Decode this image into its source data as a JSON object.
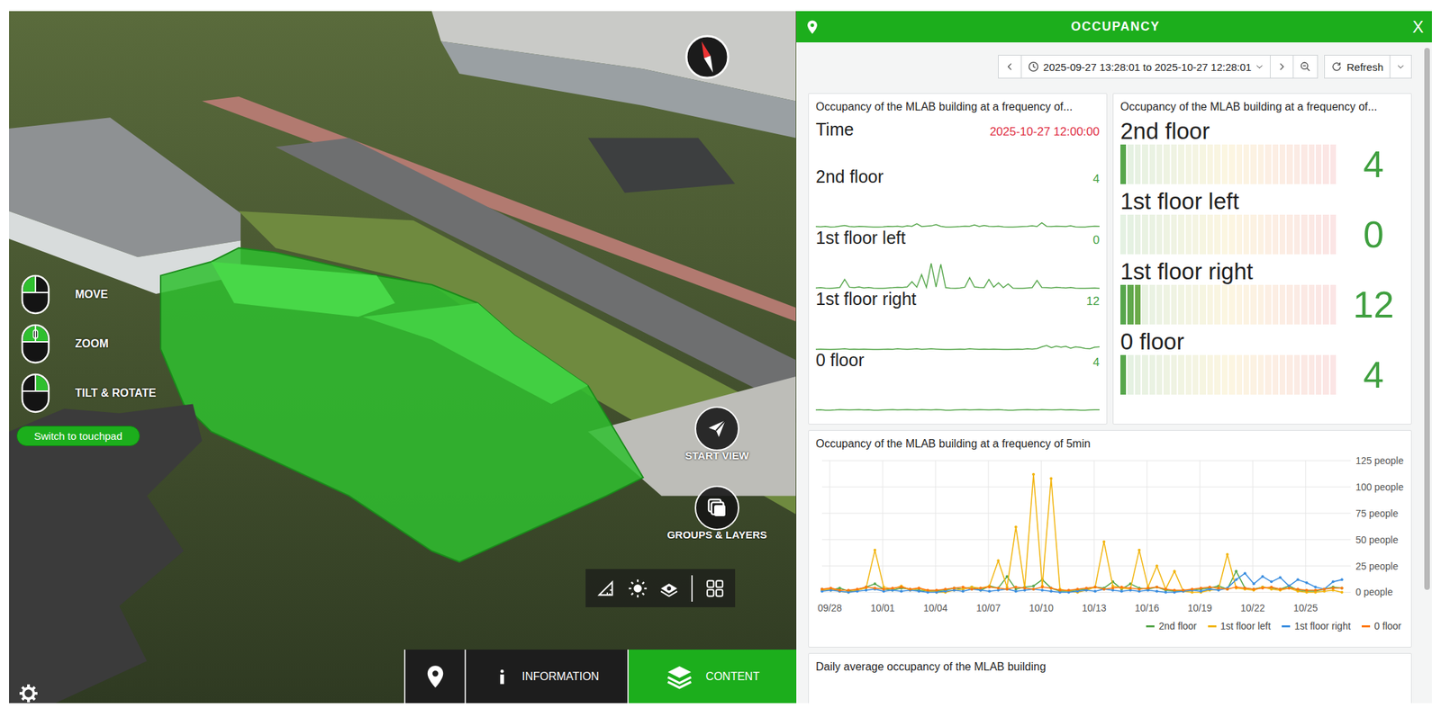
{
  "map": {
    "controls": [
      {
        "label": "MOVE"
      },
      {
        "label": "ZOOM"
      },
      {
        "label": "TILT & ROTATE"
      }
    ],
    "touchpad_button": "Switch to touchpad",
    "actions": [
      {
        "label": "START VIEW"
      },
      {
        "label": "GROUPS & LAYERS"
      }
    ],
    "bottom_bar": [
      {
        "kind": "pin",
        "selected": false
      },
      {
        "kind": "info",
        "label": "INFORMATION",
        "selected": false
      },
      {
        "kind": "content",
        "label": "CONTENT",
        "selected": true
      }
    ]
  },
  "panel": {
    "title": "OCCUPANCY",
    "close": "X",
    "time_range": "2025-09-27 13:28:01 to 2025-10-27 12:28:01",
    "refresh": "Refresh"
  },
  "stat_panel": {
    "title": "Occupancy of the MLAB building at a frequency of...",
    "time_label": "Time",
    "time_value": "2025-10-27 12:00:00",
    "rows": [
      {
        "name": "2nd floor",
        "value": "4"
      },
      {
        "name": "1st floor left",
        "value": "0"
      },
      {
        "name": "1st floor right",
        "value": "12"
      },
      {
        "name": "0 floor",
        "value": "4"
      }
    ]
  },
  "gauge_panel": {
    "title": "Occupancy of the MLAB building at a frequency of...",
    "rows": [
      {
        "name": "2nd floor",
        "value": "4",
        "level": 0.032
      },
      {
        "name": "1st floor left",
        "value": "0",
        "level": 0
      },
      {
        "name": "1st floor right",
        "value": "12",
        "level": 0.096
      },
      {
        "name": "0 floor",
        "value": "4",
        "level": 0.032
      }
    ]
  },
  "chart": {
    "title": "Occupancy of the MLAB building at a frequency of 5min",
    "y_ticks": [
      "0 people",
      "25 people",
      "50 people",
      "75 people",
      "100 people",
      "125 people"
    ],
    "x_ticks": [
      "09/28",
      "10/01",
      "10/04",
      "10/07",
      "10/10",
      "10/13",
      "10/16",
      "10/19",
      "10/22",
      "10/25"
    ],
    "series": [
      {
        "name": "2nd floor",
        "color": "#56a64b",
        "values": [
          3,
          2,
          4,
          1,
          2,
          5,
          8,
          3,
          2,
          4,
          3,
          2,
          1,
          1,
          2,
          4,
          3,
          5,
          2,
          6,
          4,
          15,
          3,
          5,
          6,
          12,
          4,
          1,
          1,
          2,
          3,
          5,
          4,
          10,
          3,
          8,
          4,
          3,
          5,
          2,
          1,
          1,
          2,
          3,
          4,
          6,
          3,
          20,
          4,
          3,
          5,
          4,
          3,
          6,
          2,
          1,
          1,
          3,
          5,
          4
        ]
      },
      {
        "name": "1st floor left",
        "color": "#f2b50f",
        "values": [
          2,
          3,
          1,
          0,
          2,
          4,
          40,
          5,
          3,
          6,
          2,
          4,
          1,
          0,
          0,
          2,
          3,
          5,
          4,
          6,
          30,
          5,
          62,
          4,
          112,
          6,
          108,
          3,
          1,
          0,
          2,
          5,
          48,
          6,
          4,
          3,
          40,
          5,
          25,
          3,
          20,
          1,
          0,
          0,
          2,
          3,
          36,
          4,
          3,
          2,
          5,
          3,
          2,
          4,
          1,
          0,
          0,
          1,
          2,
          0
        ]
      },
      {
        "name": "1st floor right",
        "color": "#3d8fe0",
        "values": [
          1,
          2,
          1,
          0,
          1,
          2,
          3,
          1,
          2,
          1,
          2,
          1,
          0,
          0,
          1,
          2,
          1,
          3,
          2,
          1,
          2,
          3,
          1,
          2,
          3,
          2,
          1,
          0,
          0,
          1,
          2,
          1,
          3,
          2,
          1,
          2,
          1,
          2,
          1,
          0,
          0,
          1,
          2,
          1,
          3,
          2,
          4,
          12,
          18,
          8,
          15,
          10,
          14,
          6,
          12,
          9,
          5,
          3,
          10,
          12
        ]
      },
      {
        "name": "0 floor",
        "color": "#ff780a",
        "values": [
          3,
          4,
          2,
          2,
          3,
          5,
          4,
          3,
          4,
          5,
          3,
          4,
          2,
          2,
          3,
          4,
          5,
          3,
          4,
          5,
          4,
          3,
          5,
          4,
          3,
          5,
          4,
          2,
          2,
          3,
          4,
          5,
          3,
          4,
          5,
          4,
          3,
          4,
          5,
          3,
          2,
          2,
          3,
          4,
          5,
          4,
          3,
          5,
          4,
          3,
          4,
          5,
          3,
          4,
          3,
          2,
          2,
          3,
          4,
          4
        ]
      }
    ]
  },
  "daily_panel": {
    "title": "Daily average occupancy of the MLAB building"
  }
}
